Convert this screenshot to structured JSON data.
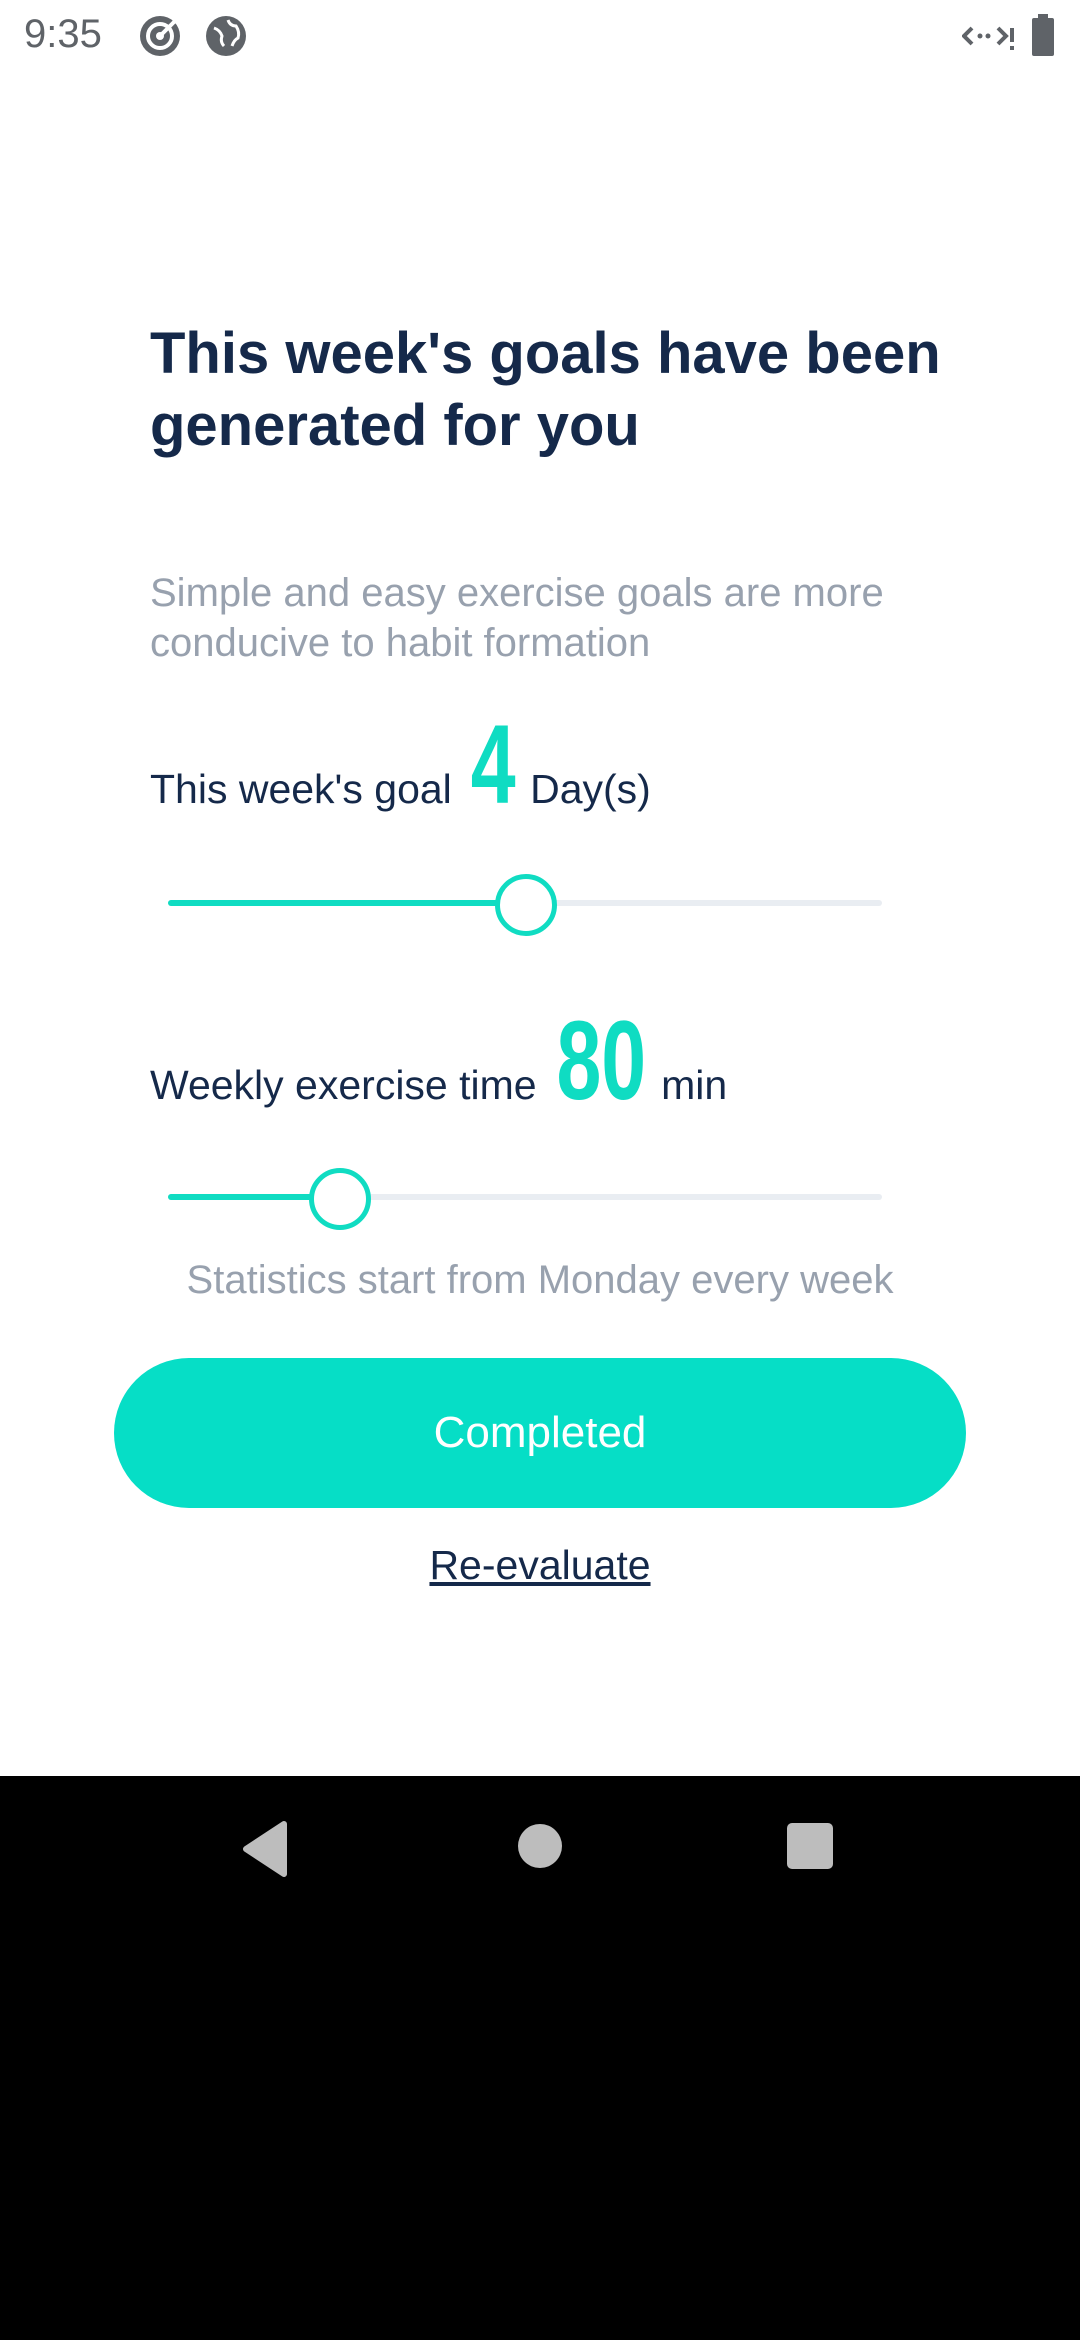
{
  "status_bar": {
    "time": "9:35",
    "icons": [
      "target-icon",
      "globe-icon",
      "data-arrows-icon",
      "battery-icon"
    ]
  },
  "main": {
    "title": "This week's goals have been generated for you",
    "subtitle": "Simple and easy exercise goals are more conducive to habit formation",
    "days_goal": {
      "label": "This week's goal",
      "value": "4",
      "unit": "Day(s)",
      "slider_fraction": 0.5
    },
    "time_goal": {
      "label": "Weekly exercise time",
      "value": "80",
      "unit": "min",
      "slider_fraction": 0.24
    },
    "stats_note": "Statistics start from Monday every week",
    "completed_button": "Completed",
    "reevaluate_link": "Re-evaluate"
  },
  "colors": {
    "accent": "#06dec6",
    "title_text": "#15294a",
    "muted_text": "#98a1ae",
    "track": "#e9edf2"
  },
  "nav_bar": {
    "icons": [
      "back-icon",
      "home-icon",
      "recents-icon"
    ]
  }
}
